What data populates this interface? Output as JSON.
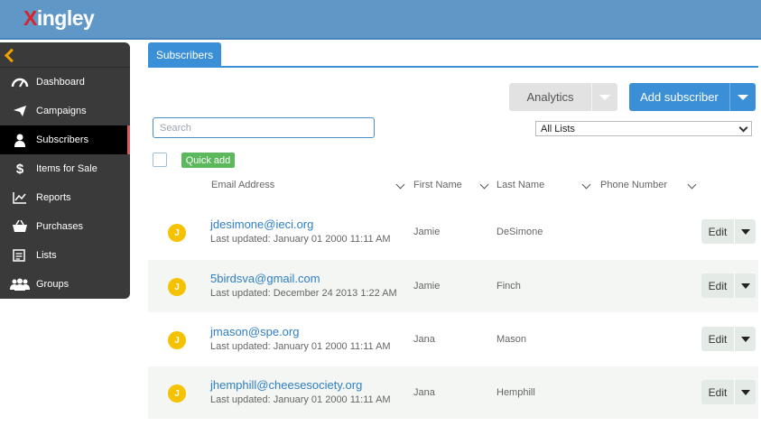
{
  "app": {
    "logo_x": "X",
    "logo_rest": "ingley"
  },
  "sidebar": {
    "items": [
      {
        "label": "Dashboard",
        "icon": "speedometer-icon"
      },
      {
        "label": "Campaigns",
        "icon": "paper-plane-icon"
      },
      {
        "label": "Subscribers",
        "icon": "user-icon",
        "active": true
      },
      {
        "label": "Items for Sale",
        "icon": "dollar-icon"
      },
      {
        "label": "Reports",
        "icon": "line-chart-icon"
      },
      {
        "label": "Purchases",
        "icon": "basket-icon"
      },
      {
        "label": "Lists",
        "icon": "list-icon"
      },
      {
        "label": "Groups",
        "icon": "users-icon"
      }
    ]
  },
  "tabs": {
    "subscribers": "Subscribers"
  },
  "toolbar": {
    "analytics_label": "Analytics",
    "add_label": "Add subscriber"
  },
  "search": {
    "placeholder": "Search",
    "value": ""
  },
  "list_filter": {
    "selected": "All Lists"
  },
  "quick_add": "Quick add",
  "table": {
    "headers": {
      "email": "Email Address",
      "first": "First Name",
      "last": "Last Name",
      "phone": "Phone Number"
    },
    "edit_label": "Edit",
    "rows": [
      {
        "initial": "J",
        "email": "jdesimone@ieci.org",
        "updated": "Last updated: January 01 2000 11:11 AM",
        "first": "Jamie",
        "last": "DeSimone"
      },
      {
        "initial": "J",
        "email": "5birdsva@gmail.com",
        "updated": "Last updated: December 24 2013 1:22 AM",
        "first": "Jamie",
        "last": "Finch"
      },
      {
        "initial": "J",
        "email": "jmason@spe.org",
        "updated": "Last updated: January 01 2000 11:11 AM",
        "first": "Jana",
        "last": "Mason"
      },
      {
        "initial": "J",
        "email": "jhemphill@cheesesociety.org",
        "updated": "Last updated: January 01 2000 11:11 AM",
        "first": "Jana",
        "last": "Hemphill"
      }
    ]
  },
  "colors": {
    "topbar": "#5f97c7",
    "accent": "#3a8fd6",
    "sidebar": "#3a3a3a",
    "avatar": "#f4c200",
    "quick_add": "#5cb85c",
    "logo_x": "#d8232a"
  }
}
